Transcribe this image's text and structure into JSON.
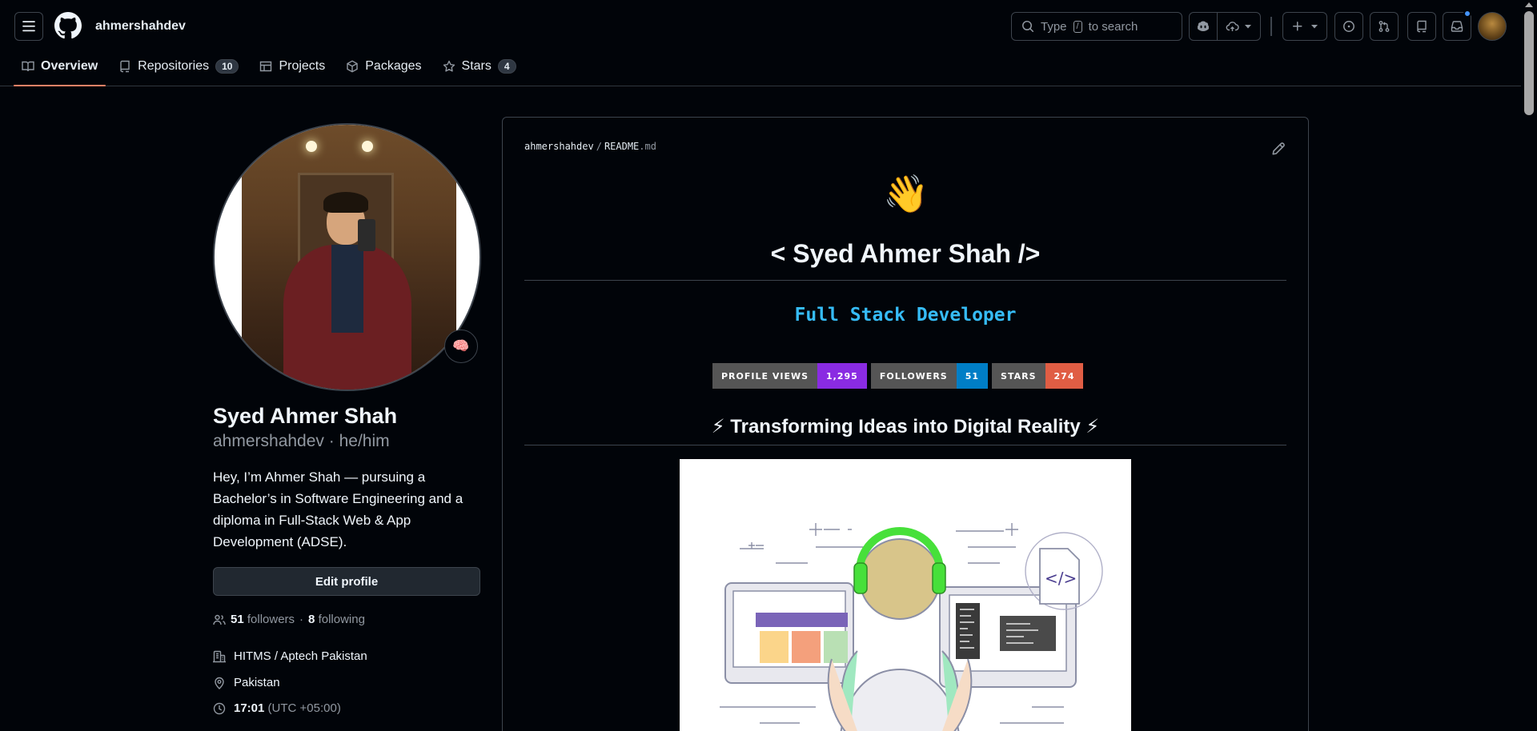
{
  "header": {
    "owner": "ahmershahdev",
    "search": {
      "prefix": "Type",
      "key": "/",
      "suffix": "to search"
    }
  },
  "tabs": [
    {
      "label": "Overview",
      "icon": "book-icon",
      "active": true
    },
    {
      "label": "Repositories",
      "icon": "repo-icon",
      "count": "10"
    },
    {
      "label": "Projects",
      "icon": "table-icon"
    },
    {
      "label": "Packages",
      "icon": "package-icon"
    },
    {
      "label": "Stars",
      "icon": "star-icon",
      "count": "4"
    }
  ],
  "profile": {
    "name": "Syed Ahmer Shah",
    "login": "ahmershahdev · he/him",
    "status_emoji": "🧠",
    "bio": "Hey, I’m Ahmer Shah — pursuing a Bachelor’s in Software Engineering and a diploma in Full-Stack Web & App Development (ADSE).",
    "edit_label": "Edit profile",
    "followers_count": "51",
    "followers_label": "followers",
    "following_count": "8",
    "following_label": "following",
    "separator": "·",
    "organization": "HITMS / Aptech Pakistan",
    "location": "Pakistan",
    "local_time": "17:01",
    "timezone": "(UTC +05:00)"
  },
  "readme": {
    "path_owner": "ahmershahdev",
    "path_sep": "/",
    "path_file": "README",
    "path_ext": ".md",
    "wave_emoji": "👋",
    "title": "< Syed Ahmer Shah />",
    "subtitle": "Full Stack Developer",
    "badges": [
      {
        "label": "PROFILE VIEWS",
        "value": "1,295",
        "color": "#8a2be2"
      },
      {
        "label": "FOLLOWERS",
        "value": "51",
        "color": "#007ec6"
      },
      {
        "label": "STARS",
        "value": "274",
        "color": "#e05d44"
      }
    ],
    "tagline": "⚡ Transforming Ideas into Digital Reality ⚡",
    "code_tag": "</>"
  },
  "colors": {
    "accent_tab": "#f78166",
    "subtitle": "#36bcf7",
    "headphones": "#47e03a"
  }
}
